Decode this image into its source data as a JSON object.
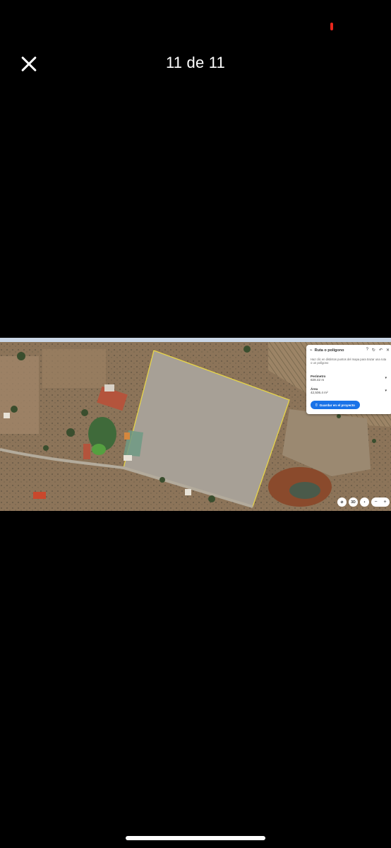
{
  "viewer": {
    "counter": "11 de 11"
  },
  "measure_panel": {
    "title": "Ruta o polígono",
    "help_text": "Haz clic en distintos puntos del mapa para trazar una ruta o un polígono",
    "perimeter_label": "Perímetro",
    "perimeter_value": "828.42 m",
    "area_label": "Área",
    "area_value": "42,506.4 m²",
    "save_label": "Guardar en el proyecto"
  },
  "map_controls": {
    "compass": "⊘",
    "view_3d": "3D",
    "zoom_in": "+",
    "zoom_out": "−"
  },
  "colors": {
    "polygon_stroke": "#e6d44a",
    "save_button": "#1a73e8",
    "status_dot": "#e8261c"
  }
}
